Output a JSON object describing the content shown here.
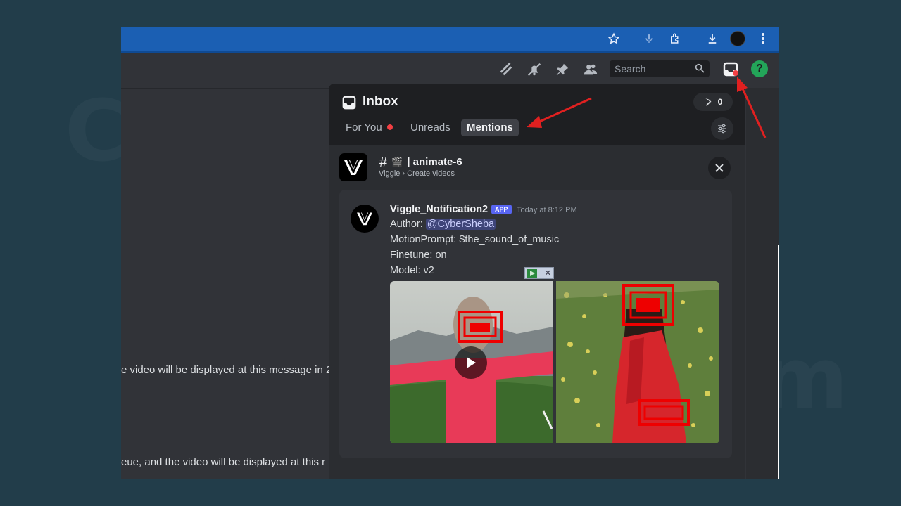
{
  "browser": {
    "icons": [
      "star-icon",
      "mic-icon",
      "extension-icon",
      "download-icon",
      "profile-avatar",
      "kebab-menu-icon"
    ]
  },
  "discord_header": {
    "search_placeholder": "Search",
    "help_symbol": "?"
  },
  "chat": {
    "lines": [
      "e video will be displayed at this message in 2",
      "eue, and the video will be displayed at this r"
    ]
  },
  "inbox": {
    "title": "Inbox",
    "badge_count": "0",
    "tabs": [
      {
        "label": "For You",
        "unread": true
      },
      {
        "label": "Unreads",
        "unread": false
      },
      {
        "label": "Mentions",
        "unread": false,
        "active": true
      }
    ],
    "channel": {
      "hash": "#",
      "emoji": "🎬",
      "name": "| animate-6",
      "breadcrumb": "Viggle › Create videos"
    },
    "message": {
      "author": "Viggle_Notification2",
      "badge": "APP",
      "timestamp": "Today at 8:12 PM",
      "author_label": "Author: ",
      "mention": "@CyberSheba",
      "motion_prompt": "MotionPrompt: $the_sound_of_music",
      "finetune": "Finetune: on",
      "model": "Model: v2"
    }
  },
  "colors": {
    "accent": "#5865f2",
    "status_red": "#f23f43",
    "help_green": "#23a559",
    "annotation_red": "#e02020",
    "chrome_blue": "#1b5fb3"
  }
}
